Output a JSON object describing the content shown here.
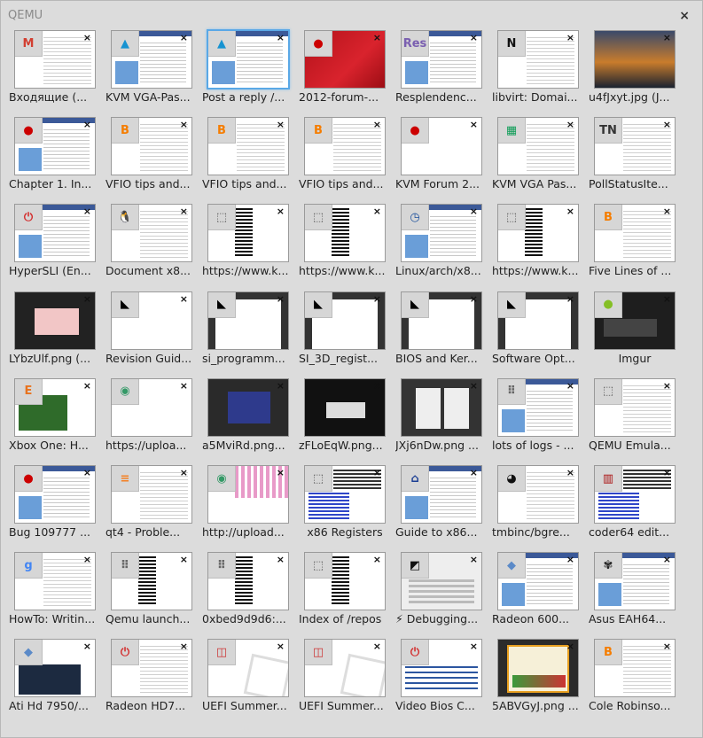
{
  "window": {
    "title": "QEMU",
    "close_label": "×"
  },
  "close_glyph": "×",
  "tiles": [
    {
      "label": "Входящие (...",
      "icon": "gmail-icon",
      "glyph": "M",
      "color": "#d23f31",
      "thumb": "lines"
    },
    {
      "label": "KVM VGA-Pas...",
      "icon": "arch-icon",
      "glyph": "▲",
      "color": "#1793d1",
      "thumb": "web"
    },
    {
      "label": "Post a reply /...",
      "icon": "arch-icon",
      "glyph": "▲",
      "color": "#1793d1",
      "thumb": "web",
      "selected": true
    },
    {
      "label": "2012-forum-...",
      "icon": "redhat-icon",
      "glyph": "●",
      "color": "#cc0000",
      "thumb": "red"
    },
    {
      "label": "Resplendenc...",
      "icon": "res-icon",
      "glyph": "Res",
      "color": "#7a5fb0",
      "thumb": "web"
    },
    {
      "label": "libvirt: Domai...",
      "icon": "libvirt-icon",
      "glyph": "N",
      "color": "#111111",
      "thumb": "lines"
    },
    {
      "label": "u4fJxyt.jpg (J...",
      "icon": "image-icon",
      "glyph": "",
      "color": "#444444",
      "thumb": "photo"
    },
    {
      "label": "Chapter 1. In...",
      "icon": "redhat-icon",
      "glyph": "●",
      "color": "#cc0000",
      "thumb": "web"
    },
    {
      "label": "VFIO tips and...",
      "icon": "blogger-icon",
      "glyph": "B",
      "color": "#f57d00",
      "thumb": "lines"
    },
    {
      "label": "VFIO tips and...",
      "icon": "blogger-icon",
      "glyph": "B",
      "color": "#f57d00",
      "thumb": "lines"
    },
    {
      "label": "VFIO tips and...",
      "icon": "blogger-icon",
      "glyph": "B",
      "color": "#f57d00",
      "thumb": "lines"
    },
    {
      "label": "KVM Forum 2...",
      "icon": "redhat-icon",
      "glyph": "●",
      "color": "#cc0000",
      "thumb": "blank"
    },
    {
      "label": "KVM VGA Pas...",
      "icon": "sheets-icon",
      "glyph": "▦",
      "color": "#0f9d58",
      "thumb": "lines"
    },
    {
      "label": "PollStatusIte...",
      "icon": "tn-icon",
      "glyph": "TN",
      "color": "#333333",
      "thumb": "lines"
    },
    {
      "label": "HyperSLI (En...",
      "icon": "power-icon",
      "glyph": "⏻",
      "color": "#d32f2f",
      "thumb": "web"
    },
    {
      "label": "Document x8...",
      "icon": "linux-icon",
      "glyph": "🐧",
      "color": "#333333",
      "thumb": "lines"
    },
    {
      "label": "https://www.k...",
      "icon": "blank-page-icon",
      "glyph": "⬚",
      "color": "#555555",
      "thumb": "dark-lines"
    },
    {
      "label": "https://www.k...",
      "icon": "blank-page-icon",
      "glyph": "⬚",
      "color": "#555555",
      "thumb": "dark-lines"
    },
    {
      "label": "Linux/arch/x8...",
      "icon": "clock-icon",
      "glyph": "◷",
      "color": "#1a4f9c",
      "thumb": "web"
    },
    {
      "label": "https://www.k...",
      "icon": "blank-page-icon",
      "glyph": "⬚",
      "color": "#555555",
      "thumb": "dark-lines"
    },
    {
      "label": "Five Lines of ...",
      "icon": "blogger-icon",
      "glyph": "B",
      "color": "#f57d00",
      "thumb": "lines"
    },
    {
      "label": "LYbzUlf.png (...",
      "icon": "image-icon",
      "glyph": "",
      "color": "#444444",
      "thumb": "dark-pink"
    },
    {
      "label": "Revision Guid...",
      "icon": "amd-icon",
      "glyph": "◣",
      "color": "#000000",
      "thumb": "blank"
    },
    {
      "label": "si_programm...",
      "icon": "amd-icon",
      "glyph": "◣",
      "color": "#000000",
      "thumb": "dark-frame"
    },
    {
      "label": "SI_3D_regist...",
      "icon": "amd-icon",
      "glyph": "◣",
      "color": "#000000",
      "thumb": "dark-frame"
    },
    {
      "label": "BIOS and Ker...",
      "icon": "amd-icon",
      "glyph": "◣",
      "color": "#000000",
      "thumb": "dark-frame"
    },
    {
      "label": "Software Opt...",
      "icon": "amd-icon",
      "glyph": "◣",
      "color": "#000000",
      "thumb": "dark-frame"
    },
    {
      "label": "Imgur",
      "icon": "imgur-icon",
      "glyph": "●",
      "color": "#85bf25",
      "thumb": "dark",
      "center": true
    },
    {
      "label": "Xbox One: H...",
      "icon": "e-icon",
      "glyph": "E",
      "color": "#e8731e",
      "thumb": "green"
    },
    {
      "label": "https://uploa...",
      "icon": "wikimedia-icon",
      "glyph": "◉",
      "color": "#339966",
      "thumb": "blank"
    },
    {
      "label": "a5MviRd.png...",
      "icon": "image-icon",
      "glyph": "",
      "color": "#444444",
      "thumb": "dark-blue"
    },
    {
      "label": "zFLoEqW.png...",
      "icon": "image-icon",
      "glyph": "",
      "color": "#444444",
      "thumb": "dark-dialog"
    },
    {
      "label": "JXj6nDw.png ...",
      "icon": "image-icon",
      "glyph": "",
      "color": "#444444",
      "thumb": "dark-doc"
    },
    {
      "label": "lots of logs - ...",
      "icon": "grid-icon",
      "glyph": "⠿",
      "color": "#666666",
      "thumb": "web"
    },
    {
      "label": "QEMU Emula...",
      "icon": "blank-page-icon",
      "glyph": "⬚",
      "color": "#555555",
      "thumb": "lines"
    },
    {
      "label": "Bug 109777 ...",
      "icon": "redhat-icon",
      "glyph": "●",
      "color": "#cc0000",
      "thumb": "web"
    },
    {
      "label": "qt4 - Proble...",
      "icon": "stack-icon",
      "glyph": "≡",
      "color": "#f48024",
      "thumb": "lines"
    },
    {
      "label": "http://upload...",
      "icon": "wikimedia-icon",
      "glyph": "◉",
      "color": "#339966",
      "thumb": "pink"
    },
    {
      "label": "x86 Registers",
      "icon": "blank-page-icon",
      "glyph": "⬚",
      "color": "#555555",
      "thumb": "blue-lines",
      "center": true
    },
    {
      "label": "Guide to x86...",
      "icon": "uva-icon",
      "glyph": "⌂",
      "color": "#1c3f94",
      "thumb": "web"
    },
    {
      "label": "tmbinc/bgre...",
      "icon": "github-icon",
      "glyph": "◕",
      "color": "#111111",
      "thumb": "lines"
    },
    {
      "label": "coder64 edit...",
      "icon": "coder-icon",
      "glyph": "▥",
      "color": "#aa1111",
      "thumb": "blue-lines"
    },
    {
      "label": "HowTo: Writin...",
      "icon": "google-icon",
      "glyph": "g",
      "color": "#4285f4",
      "thumb": "lines"
    },
    {
      "label": "Qemu launch...",
      "icon": "grid-icon",
      "glyph": "⠿",
      "color": "#666666",
      "thumb": "dark-lines"
    },
    {
      "label": "0xbed9d9d6:...",
      "icon": "grid-icon",
      "glyph": "⠿",
      "color": "#666666",
      "thumb": "dark-lines"
    },
    {
      "label": "Index of /repos",
      "icon": "blank-page-icon",
      "glyph": "⬚",
      "color": "#555555",
      "thumb": "dark-lines"
    },
    {
      "label": "⚡ Debugging...",
      "icon": "debug-icon",
      "glyph": "◩",
      "color": "#111111",
      "thumb": "grey"
    },
    {
      "label": "Radeon 600...",
      "icon": "drop-icon",
      "glyph": "◆",
      "color": "#5b8ac8",
      "thumb": "web"
    },
    {
      "label": "Asus EAH64...",
      "icon": "asus-icon",
      "glyph": "✾",
      "color": "#222222",
      "thumb": "web"
    },
    {
      "label": "Ati Hd 7950/...",
      "icon": "drop-icon",
      "glyph": "◆",
      "color": "#5b8ac8",
      "thumb": "dark-web"
    },
    {
      "label": "Radeon HD7...",
      "icon": "power-icon",
      "glyph": "⏻",
      "color": "#d32f2f",
      "thumb": "lines"
    },
    {
      "label": "UEFI Summer...",
      "icon": "uefi-icon",
      "glyph": "◫",
      "color": "#cc3333",
      "thumb": "uefi"
    },
    {
      "label": "UEFI Summer...",
      "icon": "uefi-icon",
      "glyph": "◫",
      "color": "#cc3333",
      "thumb": "uefi"
    },
    {
      "label": "Video Bios C...",
      "icon": "power-icon",
      "glyph": "⏻",
      "color": "#d32f2f",
      "thumb": "table"
    },
    {
      "label": "5ABVGyJ.png ...",
      "icon": "image-icon",
      "glyph": "",
      "color": "#444444",
      "thumb": "dark-chart"
    },
    {
      "label": "Cole Robinso...",
      "icon": "blogger-icon",
      "glyph": "B",
      "color": "#f57d00",
      "thumb": "lines"
    }
  ]
}
